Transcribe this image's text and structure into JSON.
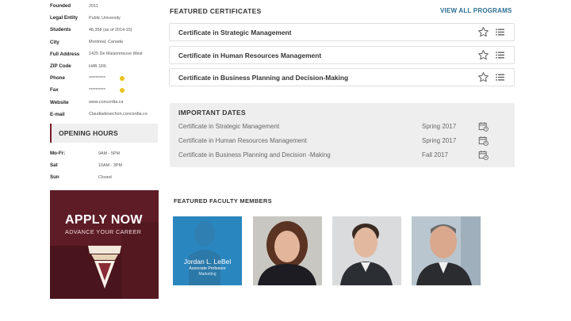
{
  "info": [
    {
      "key": "Founded",
      "value": "2011"
    },
    {
      "key": "Legal Entity",
      "value": "Public University"
    },
    {
      "key": "Students",
      "value": "46,358 (as of 2014-15)"
    },
    {
      "key": "City",
      "value": "Montréal, Canada"
    },
    {
      "key": "Full Address",
      "value": "1425 De Maisonneuve West"
    },
    {
      "key": "ZIP Code",
      "value": "H4B 1R6"
    },
    {
      "key": "Phone",
      "value": "**********"
    },
    {
      "key": "Fax",
      "value": "**********"
    },
    {
      "key": "Website",
      "value": "www.concordia.ca"
    },
    {
      "key": "E-mail",
      "value": "Claudiadesechon.concordia.co"
    }
  ],
  "opening_hours": {
    "title": "OPENING HOURS",
    "rows": [
      {
        "day": "Mo-Fr:",
        "hours": "9AM - 5PM"
      },
      {
        "day": "Sat",
        "hours": "10AM - 3PM"
      },
      {
        "day": "Sun",
        "hours": "Closed"
      }
    ]
  },
  "banner": {
    "title": "APPLY NOW",
    "subtitle": "ADVANCE YOUR CAREER",
    "color": "#5e1c26"
  },
  "certificates": {
    "title": "FEATURED CERTIFICATES",
    "view_all": "VIEW ALL PROGRAMS",
    "items": [
      {
        "name": "Certificate in Strategic Management"
      },
      {
        "name": "Certificate in Human Resources Management"
      },
      {
        "name": "Certificate in Business Planning and Decision-Making"
      }
    ]
  },
  "important_dates": {
    "title": "IMPORTANT DATES",
    "rows": [
      {
        "name": "Certificate in Strategic Management",
        "date": "Spring 2017"
      },
      {
        "name": "Certificate in Human Resources Management",
        "date": "Spring 2017"
      },
      {
        "name": "Certificate in Business Planning and Decision -Making",
        "date": "Fall 2017"
      }
    ]
  },
  "faculty": {
    "title": "FEATURED FACULTY MEMBERS",
    "members": [
      {
        "name": "Jordan L. LeBel",
        "role": "Associate Professor",
        "dept": "Marketing"
      }
    ]
  },
  "colors": {
    "accent": "#2b6e93",
    "brand": "#7a1d2b",
    "badge": "#e8c21e"
  }
}
